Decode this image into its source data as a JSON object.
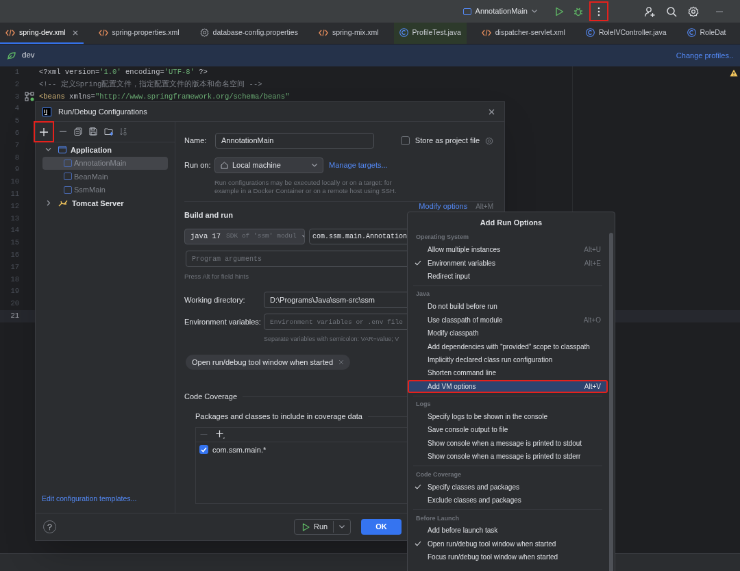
{
  "toolbar": {
    "run_config": "AnnotationMain",
    "more_highlighted": true
  },
  "tabs": [
    {
      "label": "spring-dev.xml",
      "kind": "xml",
      "selected": true,
      "highlighted": false
    },
    {
      "label": "spring-properties.xml",
      "kind": "xml",
      "selected": false,
      "highlighted": false
    },
    {
      "label": "database-config.properties",
      "kind": "properties",
      "selected": false,
      "highlighted": false
    },
    {
      "label": "spring-mix.xml",
      "kind": "xml",
      "selected": false,
      "highlighted": false
    },
    {
      "label": "ProfileTest.java",
      "kind": "class",
      "selected": false,
      "highlighted": true
    },
    {
      "label": "dispatcher-servlet.xml",
      "kind": "xml",
      "selected": false,
      "highlighted": false
    },
    {
      "label": "RoleIVController.java",
      "kind": "class",
      "selected": false,
      "highlighted": false
    },
    {
      "label": "RoleDat",
      "kind": "class",
      "selected": false,
      "highlighted": false
    }
  ],
  "profile_bar": {
    "profile": "dev",
    "link": "Change profiles.."
  },
  "editor": {
    "lines": [
      {
        "number": "1",
        "current": false,
        "tokens": [
          {
            "text": "<?xml version=",
            "kind": "plain"
          },
          {
            "text": "'1.0'",
            "kind": "string"
          },
          {
            "text": " encoding=",
            "kind": "plain"
          },
          {
            "text": "'UTF-8'",
            "kind": "string"
          },
          {
            "text": " ?>",
            "kind": "plain"
          }
        ]
      },
      {
        "number": "2",
        "current": false,
        "tokens": [
          {
            "text": "<!-- 定义Spring配置文件，指定配置文件的版本和命名空间 -->",
            "kind": "comment"
          }
        ]
      },
      {
        "number": "3",
        "current": false,
        "marker": true,
        "tokens": [
          {
            "text": "<beans",
            "kind": "tag"
          },
          {
            "text": " xmlns=",
            "kind": "plain"
          },
          {
            "text": "\"http://www.springframework.org/schema/beans\"",
            "kind": "string"
          }
        ]
      },
      {
        "number": "4",
        "current": false
      },
      {
        "number": "5",
        "current": false
      },
      {
        "number": "6",
        "current": false
      },
      {
        "number": "7",
        "current": false
      },
      {
        "number": "8",
        "current": false
      },
      {
        "number": "9",
        "current": false
      },
      {
        "number": "10",
        "current": false
      },
      {
        "number": "11",
        "current": false
      },
      {
        "number": "12",
        "current": false
      },
      {
        "number": "13",
        "current": false
      },
      {
        "number": "14",
        "current": false
      },
      {
        "number": "15",
        "current": false
      },
      {
        "number": "16",
        "current": false
      },
      {
        "number": "17",
        "current": false
      },
      {
        "number": "18",
        "current": false
      },
      {
        "number": "19",
        "current": false
      },
      {
        "number": "20",
        "current": false
      },
      {
        "number": "21",
        "current": true
      }
    ]
  },
  "dialog": {
    "title": "Run/Debug Configurations",
    "add_highlighted": true,
    "tree": [
      {
        "label": "Application",
        "expanded": true,
        "kind": "application",
        "children": [
          {
            "label": "AnnotationMain",
            "selected": true
          },
          {
            "label": "BeanMain",
            "selected": false
          },
          {
            "label": "SsmMain",
            "selected": false
          }
        ]
      },
      {
        "label": "Tomcat Server",
        "expanded": false,
        "kind": "tomcat"
      }
    ],
    "templates_link": "Edit configuration templates...",
    "name_label": "Name:",
    "name_value": "AnnotationMain",
    "store_label": "Store as project file",
    "store_checked": false,
    "run_on_label": "Run on:",
    "run_on_value": "Local machine",
    "manage_targets": "Manage targets...",
    "run_on_hint": "Run configurations may be executed locally or on a target: for example in a Docker Container or on a remote host using SSH.",
    "build_heading": "Build and run",
    "modify_options": "Modify options",
    "modify_shortcut": "Alt+M",
    "jdk_value": "java 17",
    "jdk_hint": "SDK of 'ssm' modul",
    "main_class": "com.ssm.main.Annotation",
    "program_args_placeholder": "Program arguments",
    "field_hint": "Press Alt for field hints",
    "workdir_label": "Working directory:",
    "workdir_value": "D:\\Programs\\Java\\ssm-src\\ssm",
    "env_label": "Environment variables:",
    "env_placeholder": "Environment variables or .env file",
    "env_hint": "Separate variables with semicolon: VAR=value; V",
    "chip": "Open run/debug tool window when started",
    "coverage_heading": "Code Coverage",
    "coverage_sub": "Packages and classes to include in coverage data",
    "coverage_rows": [
      {
        "label": "com.ssm.main.*",
        "checked": true
      }
    ],
    "run_button": "Run",
    "ok_button": "OK"
  },
  "popup": {
    "title": "Add Run Options",
    "sections": [
      {
        "heading": "Operating System",
        "items": [
          {
            "label": "Allow multiple instances",
            "shortcut": "Alt+U",
            "checked": false,
            "selected": false
          },
          {
            "label": "Environment variables",
            "shortcut": "Alt+E",
            "checked": true,
            "selected": false
          },
          {
            "label": "Redirect input",
            "checked": false,
            "selected": false
          }
        ]
      },
      {
        "heading": "Java",
        "items": [
          {
            "label": "Do not build before run",
            "checked": false,
            "selected": false
          },
          {
            "label": "Use classpath of module",
            "shortcut": "Alt+O",
            "checked": false,
            "selected": false
          },
          {
            "label": "Modify classpath",
            "checked": false,
            "selected": false
          },
          {
            "label": "Add dependencies with “provided” scope to classpath",
            "checked": false,
            "selected": false
          },
          {
            "label": "Implicitly declared class run configuration",
            "checked": false,
            "selected": false
          },
          {
            "label": "Shorten command line",
            "checked": false,
            "selected": false
          },
          {
            "label": "Add VM options",
            "shortcut": "Alt+V",
            "checked": false,
            "selected": true
          }
        ]
      },
      {
        "heading": "Logs",
        "items": [
          {
            "label": "Specify logs to be shown in the console",
            "checked": false,
            "selected": false
          },
          {
            "label": "Save console output to file",
            "checked": false,
            "selected": false
          },
          {
            "label": "Show console when a message is printed to stdout",
            "checked": false,
            "selected": false
          },
          {
            "label": "Show console when a message is printed to stderr",
            "checked": false,
            "selected": false
          }
        ]
      },
      {
        "heading": "Code Coverage",
        "items": [
          {
            "label": "Specify classes and packages",
            "checked": true,
            "selected": false
          },
          {
            "label": "Exclude classes and packages",
            "checked": false,
            "selected": false
          }
        ]
      },
      {
        "heading": "Before Launch",
        "items": [
          {
            "label": "Add before launch task",
            "checked": false,
            "selected": false
          },
          {
            "label": "Open run/debug tool window when started",
            "checked": true,
            "selected": false
          },
          {
            "label": "Focus run/debug tool window when started",
            "checked": false,
            "selected": false
          }
        ]
      }
    ]
  }
}
